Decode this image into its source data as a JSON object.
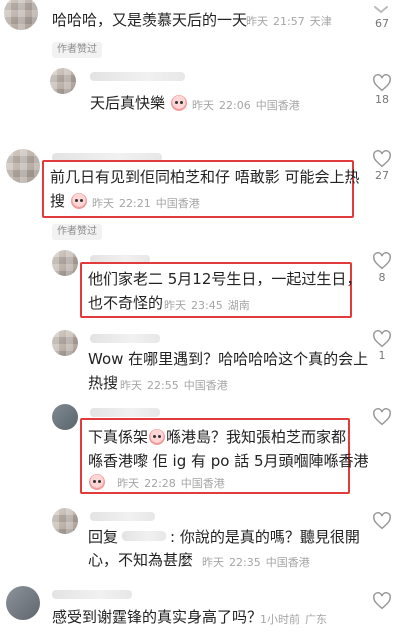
{
  "comments": [
    {
      "id": "c0",
      "text": "哈哈哈，又是羡慕天后的一天",
      "time": "昨天",
      "clock": "21:57",
      "location": "天津",
      "likes": "67",
      "badge": "作者赞过"
    },
    {
      "id": "c1",
      "text": "天后真快樂",
      "time": "昨天",
      "clock": "22:06",
      "location": "中国香港",
      "likes": "18"
    },
    {
      "id": "c2",
      "line1": "前几日有见到佢同柏芝和仔 唔敢影 可能会上热",
      "line2": "搜",
      "time": "昨天",
      "clock": "22:21",
      "location": "中国香港",
      "likes": "27",
      "badge": "作者赞过"
    },
    {
      "id": "c3",
      "line1": "他们家老二 5月12号生日，一起过生日，",
      "line2": "也不奇怪的",
      "time": "昨天",
      "clock": "23:45",
      "location": "湖南",
      "likes": "8"
    },
    {
      "id": "c4",
      "line1": "Wow 在哪里遇到？哈哈哈哈这个真的会上",
      "line2": "热搜",
      "time": "昨天",
      "clock": "22:55",
      "location": "中国香港",
      "likes": "1"
    },
    {
      "id": "c5",
      "line1a": "下真係架",
      "line1b": "喺港島？我知張柏芝而家都",
      "line2": "喺香港嚟 佢 ig 有 po 話 5月頭嗰陣喺香港",
      "time": "昨天",
      "clock": "22:28",
      "location": "中国香港",
      "likes": ""
    },
    {
      "id": "c6",
      "reply_prefix": "回复",
      "reply_rest": ": 你說的是真的嗎？聽見很開",
      "line2": "心，不知為甚麼",
      "time": "昨天",
      "clock": "22:35",
      "location": "中国香港",
      "likes": ""
    },
    {
      "id": "c7",
      "text": "感受到谢霆锋的真实身高了吗？",
      "time": "1小时前",
      "location": "广东",
      "likes": ""
    }
  ],
  "colors": {
    "highlight": "#e23b3b",
    "meta": "#a5a5a5"
  },
  "icons": {
    "like": "heart-outline-icon",
    "top_more": "chevron-down-icon"
  }
}
